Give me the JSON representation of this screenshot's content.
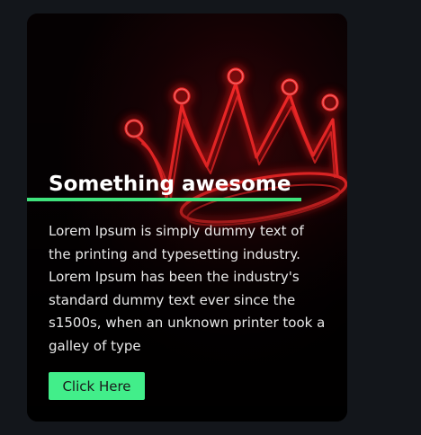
{
  "card": {
    "title": "Something awesome",
    "body": "Lorem Ipsum is simply dummy text of the printing and typesetting industry. Lorem Ipsum has been the industry's standard dummy text ever since the s1500s, when an unknown printer took a galley of type",
    "button_label": "Click Here",
    "background_image": "neon-crown-image"
  },
  "colors": {
    "page_background": "#13161b",
    "card_background": "#050102",
    "accent": "#3fe27c",
    "button": "#42ee8a",
    "neon": "#ff1a1a"
  }
}
